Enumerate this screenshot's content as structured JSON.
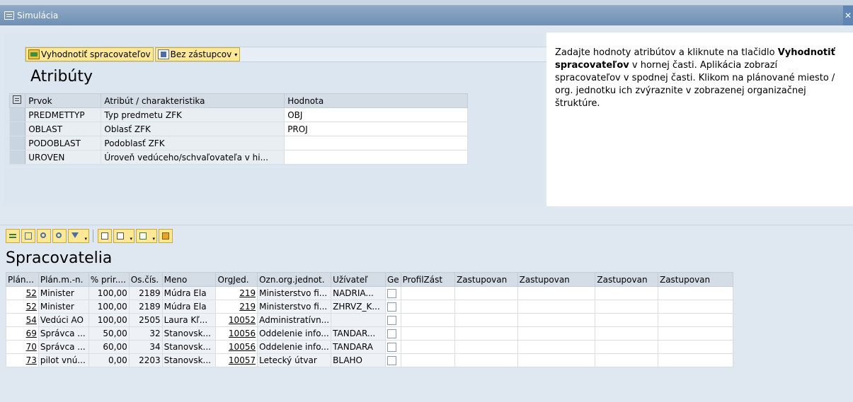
{
  "window": {
    "title": "Simulácia",
    "close_symbol": "✕"
  },
  "toolbar_top": {
    "evaluate_label": "Vyhodnotiť spracovateľov",
    "no_deputies_label": "Bez zástupcov",
    "caret": "▾"
  },
  "attributes": {
    "heading": "Atribúty",
    "columns": [
      "Prvok",
      "Atribút / charakteristika",
      "Hodnota"
    ],
    "rows": [
      {
        "prvok": "PREDMETTYP",
        "atribut": "Typ predmetu ZFK",
        "hodnota": "OBJ"
      },
      {
        "prvok": "OBLAST",
        "atribut": "Oblasť ZFK",
        "hodnota": "PROJ"
      },
      {
        "prvok": "PODOBLAST",
        "atribut": "Podoblasť ZFK",
        "hodnota": ""
      },
      {
        "prvok": "UROVEN",
        "atribut": "Úroveň vedúceho/schvaľovateľa v hi...",
        "hodnota": ""
      }
    ]
  },
  "info": {
    "text_1": "Zadajte hodnoty atribútov a kliknute na tlačidlo ",
    "text_bold": "Vyhodnotiť spracovateľov",
    "text_2": " v hornej časti. Aplikácia zobrazí spracovateľov v spodnej časti. Klikom na plánované miesto / org. jednotku ich zvýraznite v zobrazenej organizačnej štruktúre."
  },
  "processors": {
    "heading": "Spracovatelia",
    "columns": [
      "Plán...",
      "Plán.m.-n.",
      "% prir....",
      "Os.čís.",
      "Meno",
      "OrgJed.",
      "Ozn.org.jednot.",
      "Užívateľ",
      "Ge",
      "ProfilZást",
      "Zastupovan",
      "Zastupovan",
      "Zastupovan",
      "Zastupovan"
    ],
    "rows": [
      {
        "plan": "52",
        "plan_name": "Minister",
        "pct": "100,00",
        "os": "2189",
        "meno": "Múdra Ela",
        "orgjed": "219",
        "ozn": "Ministerstvo fi...",
        "user": "NADRIA..."
      },
      {
        "plan": "52",
        "plan_name": "Minister",
        "pct": "100,00",
        "os": "2189",
        "meno": "Múdra Ela",
        "orgjed": "219",
        "ozn": "Ministerstvo fi...",
        "user": "ZHRVZ_K..."
      },
      {
        "plan": "54",
        "plan_name": "Vedúci AO",
        "pct": "100,00",
        "os": "2505",
        "meno": "Laura Kľ...",
        "orgjed": "10052",
        "ozn": "Administratívn...",
        "user": ""
      },
      {
        "plan": "69",
        "plan_name": "Správca ...",
        "pct": "50,00",
        "os": "32",
        "meno": "Stanovsk...",
        "orgjed": "10056",
        "ozn": "Oddelenie info...",
        "user": "TANDAR..."
      },
      {
        "plan": "70",
        "plan_name": "Správca ...",
        "pct": "60,00",
        "os": "34",
        "meno": "Stanovsk...",
        "orgjed": "10056",
        "ozn": "Oddelenie info...",
        "user": "TANDARA"
      },
      {
        "plan": "73",
        "plan_name": "pilot vnú...",
        "pct": "0,00",
        "os": "2203",
        "meno": "Stanovsk...",
        "orgjed": "10057",
        "ozn": "Letecký útvar",
        "user": "BLAHO"
      }
    ]
  }
}
